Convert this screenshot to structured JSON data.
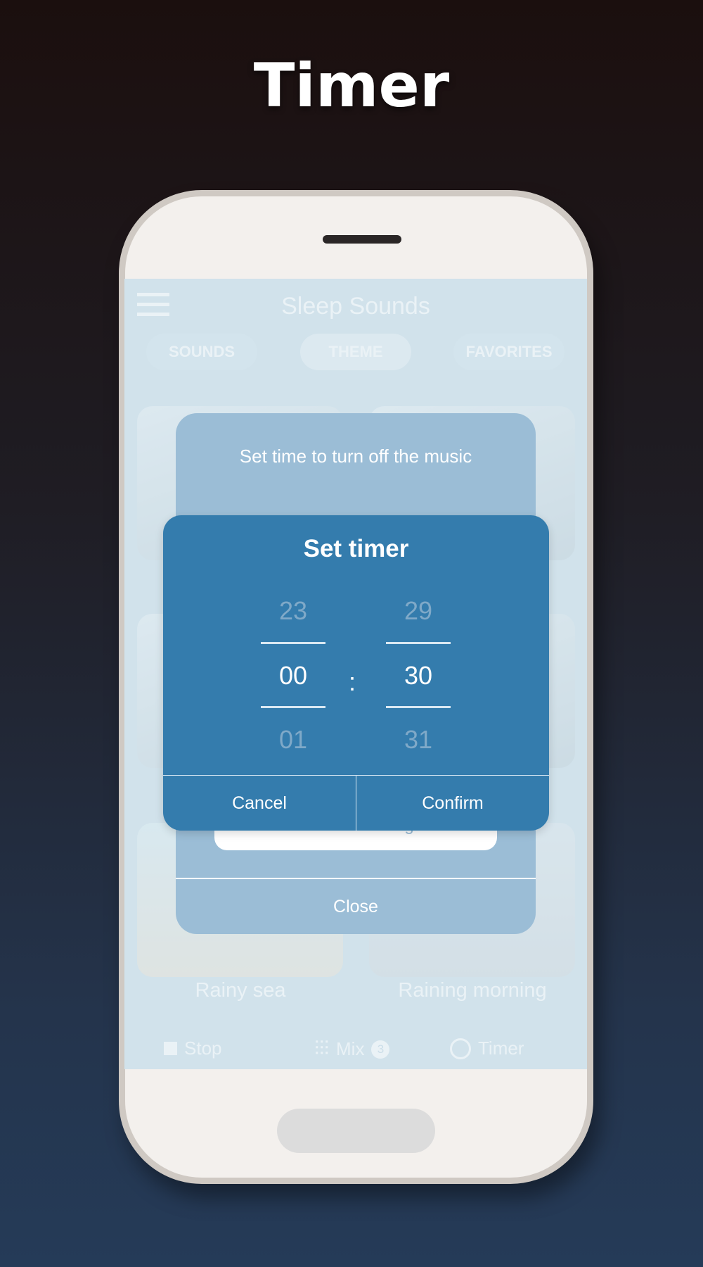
{
  "headline": "Timer",
  "app": {
    "title": "Sleep Sounds",
    "tabs": [
      {
        "label": "SOUNDS"
      },
      {
        "label": "THEME",
        "active": true
      },
      {
        "label": "FAVORITES"
      }
    ]
  },
  "cards": [
    {
      "label": ""
    },
    {
      "label": ""
    },
    {
      "label": ""
    },
    {
      "label": ""
    },
    {
      "label": "Rainy sea"
    },
    {
      "label": "Raining morning"
    }
  ],
  "bottom_bar": {
    "stop": "Stop",
    "mix": "Mix",
    "mix_count": "3",
    "timer": "Timer"
  },
  "timer_dialog": {
    "subtitle": "Set time to turn off the music",
    "exit_button": "Exit timer settings",
    "close": "Close"
  },
  "picker": {
    "title": "Set timer",
    "hours": {
      "prev": "23",
      "selected": "00",
      "next": "01"
    },
    "minutes": {
      "prev": "29",
      "selected": "30",
      "next": "31"
    },
    "separator": ":",
    "cancel": "Cancel",
    "confirm": "Confirm"
  },
  "colors": {
    "picker_bg": "#347cad",
    "dialog_bg": "#9bbdd6",
    "screen_bg": "#d1e2ec"
  }
}
